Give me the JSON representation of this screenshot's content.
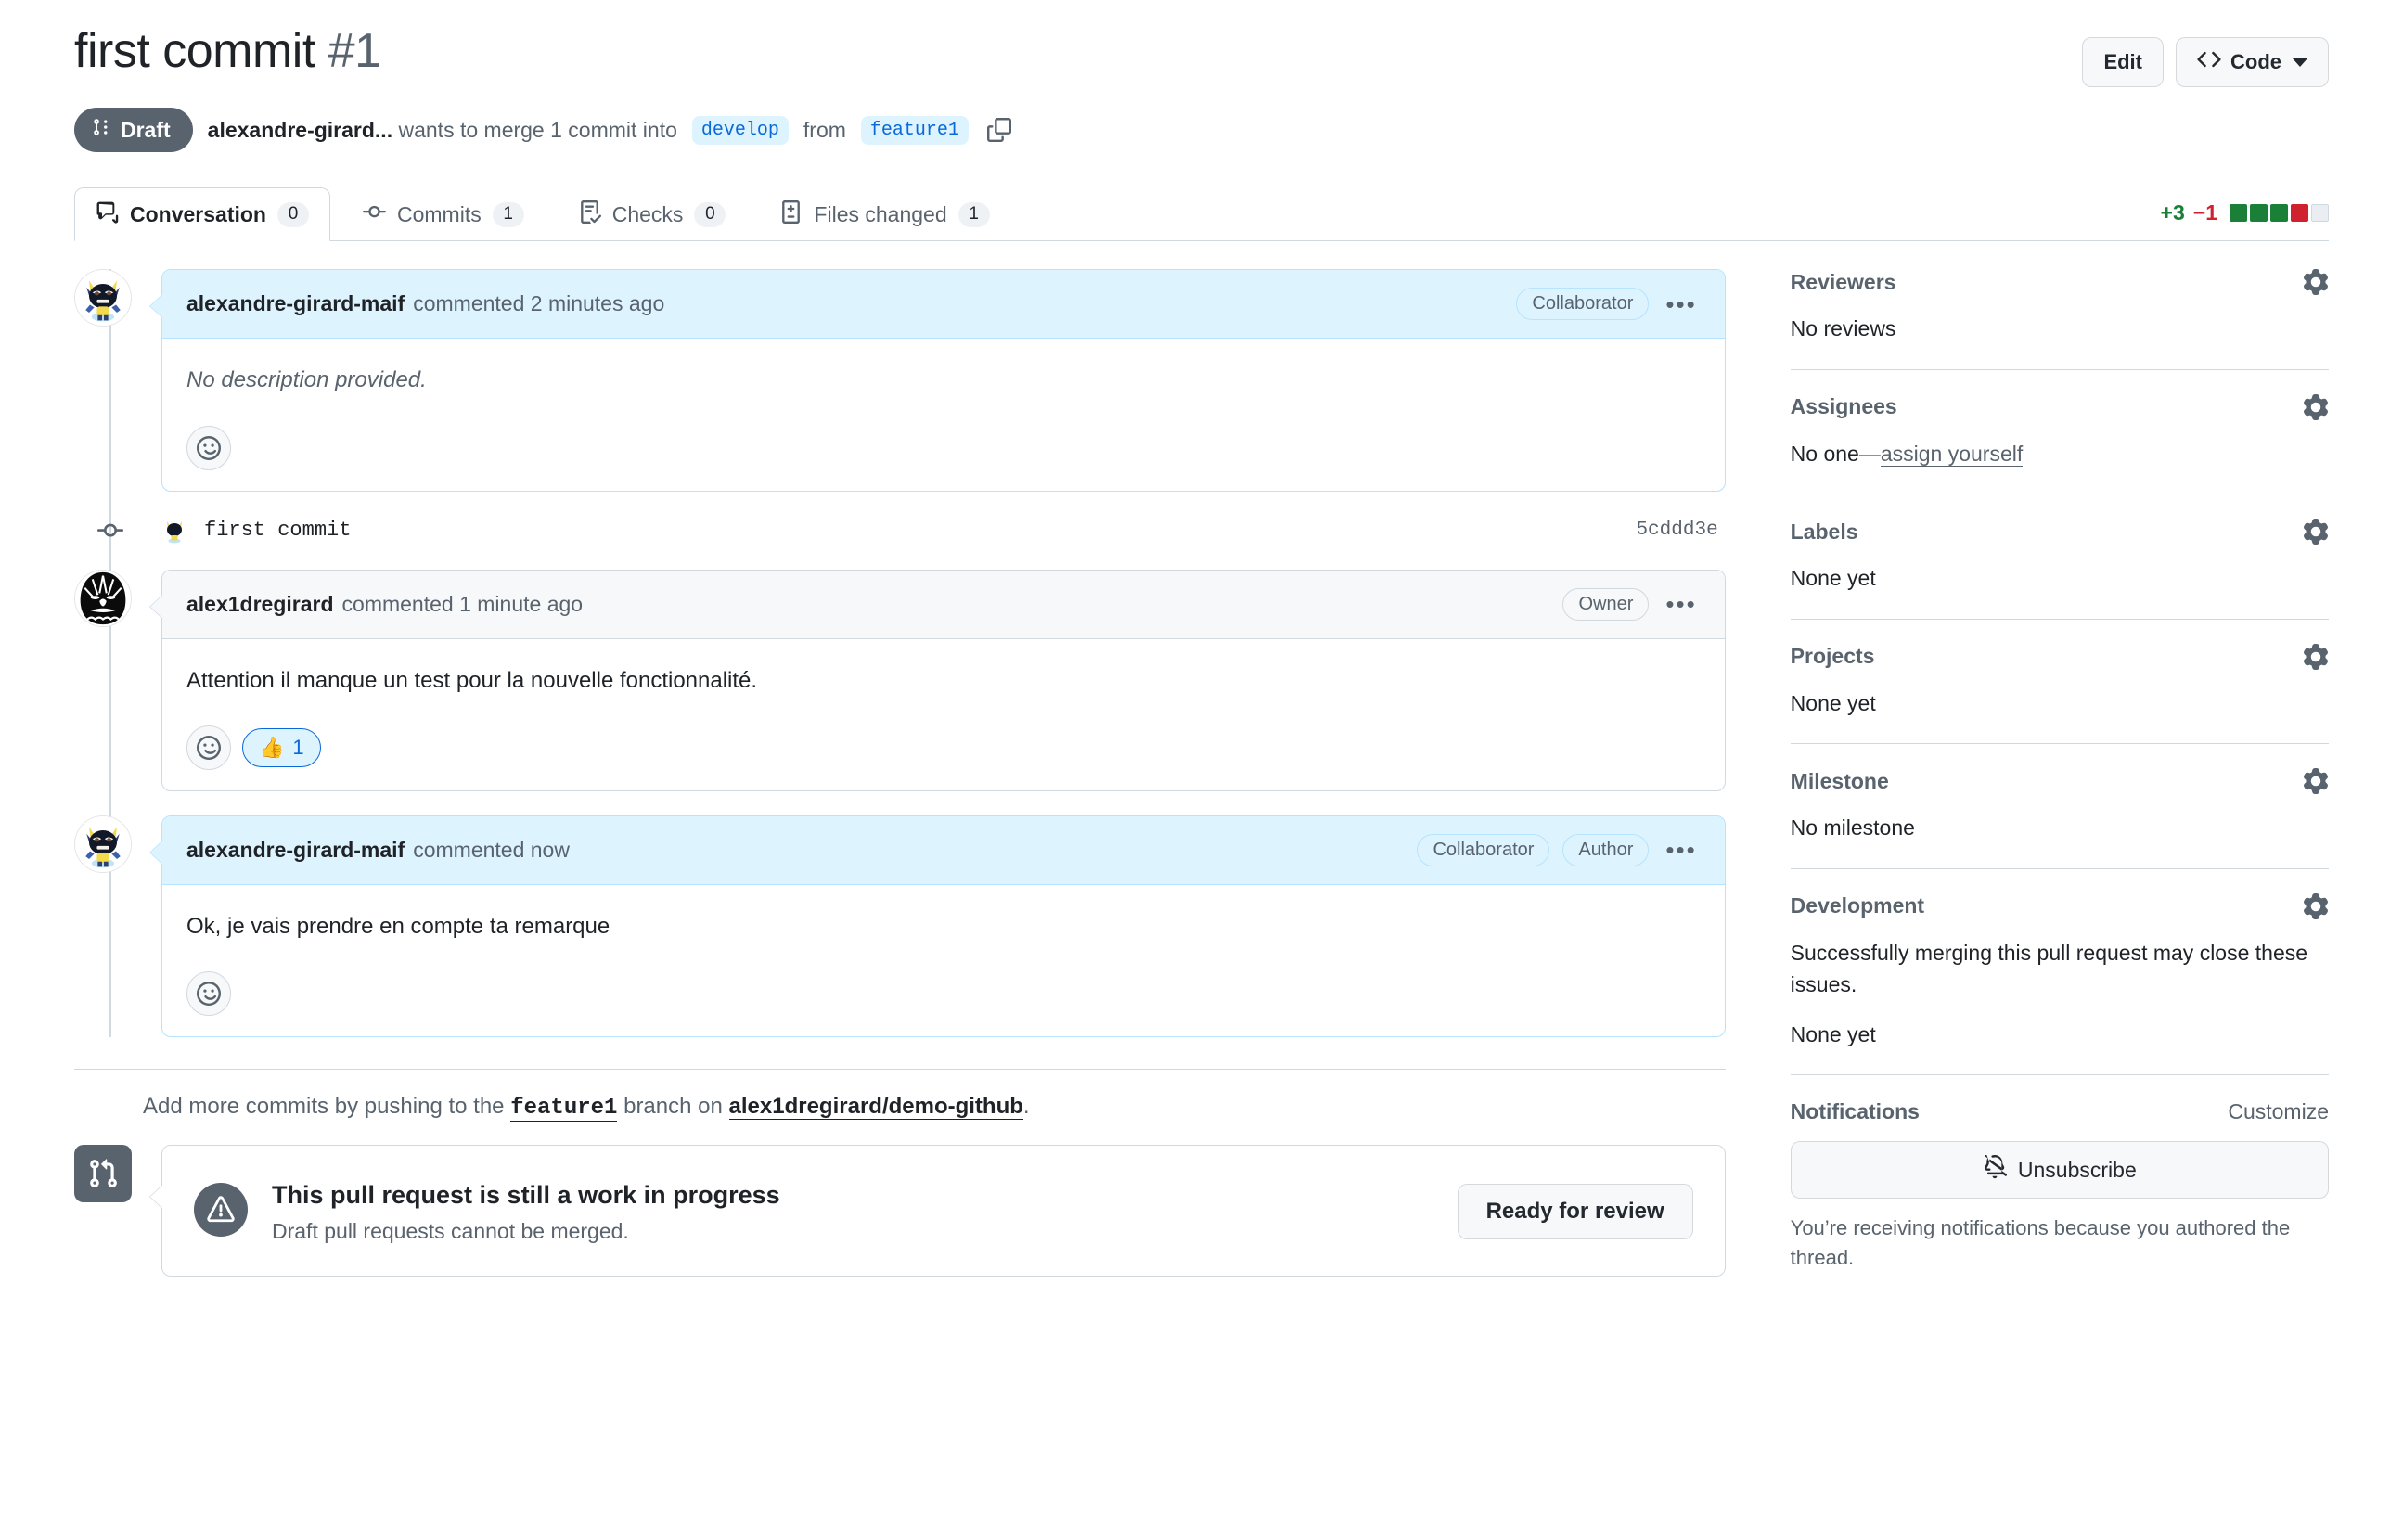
{
  "header": {
    "title": "first commit",
    "number": "#1",
    "edit_label": "Edit",
    "code_label": "Code"
  },
  "subhead": {
    "state": "Draft",
    "author": "alexandre-girard...",
    "text_before": "wants to merge 1 commit into",
    "base_branch": "develop",
    "text_middle": "from",
    "head_branch": "feature1"
  },
  "tabs": [
    {
      "label": "Conversation",
      "count": "0",
      "icon": "comment-icon",
      "active": true
    },
    {
      "label": "Commits",
      "count": "1",
      "icon": "commit-icon",
      "active": false
    },
    {
      "label": "Checks",
      "count": "0",
      "icon": "checks-icon",
      "active": false
    },
    {
      "label": "Files changed",
      "count": "1",
      "icon": "diff-icon",
      "active": false
    }
  ],
  "diffstat": {
    "additions": "+3",
    "deletions": "−1",
    "blocks": [
      "#1a7f37",
      "#1a7f37",
      "#1a7f37",
      "#cf222e",
      "#eaeef2"
    ]
  },
  "timeline": {
    "comments": [
      {
        "author": "alexandre-girard-maif",
        "action": "commented 2 minutes ago",
        "badges": [
          "Collaborator"
        ],
        "body": "No description provided.",
        "italic": true,
        "highlight": true,
        "avatar": "wolverine",
        "reaction": null
      },
      {
        "author": "alex1dregirard",
        "action": "commented 1 minute ago",
        "badges": [
          "Owner"
        ],
        "body": "Attention il manque un test pour la nouvelle fonctionnalité.",
        "italic": false,
        "highlight": false,
        "avatar": "chewbacca",
        "reaction": {
          "emoji": "👍",
          "count": "1"
        }
      },
      {
        "author": "alexandre-girard-maif",
        "action": "commented now",
        "badges": [
          "Collaborator",
          "Author"
        ],
        "body": "Ok, je vais prendre en compte ta remarque",
        "italic": false,
        "highlight": true,
        "avatar": "wolverine",
        "reaction": null
      }
    ],
    "commit": {
      "message": "first commit",
      "sha": "5cddd3e",
      "avatar": "wolverine"
    },
    "push_note": {
      "prefix": "Add more commits by pushing to the",
      "branch": "feature1",
      "middle": "branch on",
      "repo": "alex1dregirard/demo-github",
      "suffix": "."
    },
    "merge_box": {
      "title": "This pull request is still a work in progress",
      "subtitle": "Draft pull requests cannot be merged.",
      "button": "Ready for review"
    }
  },
  "sidebar": {
    "sections": [
      {
        "title": "Reviewers",
        "value": "No reviews",
        "gear": true
      },
      {
        "title": "Assignees",
        "value_prefix": "No one—",
        "value_link": "assign yourself",
        "gear": true
      },
      {
        "title": "Labels",
        "value": "None yet",
        "gear": true
      },
      {
        "title": "Projects",
        "value": "None yet",
        "gear": true
      },
      {
        "title": "Milestone",
        "value": "No milestone",
        "gear": true
      },
      {
        "title": "Development",
        "value": "Successfully merging this pull request may close these issues.",
        "value2": "None yet",
        "gear": true
      }
    ],
    "notifications": {
      "title": "Notifications",
      "customize": "Customize",
      "button": "Unsubscribe",
      "note": "You’re receiving notifications because you authored the thread."
    }
  }
}
